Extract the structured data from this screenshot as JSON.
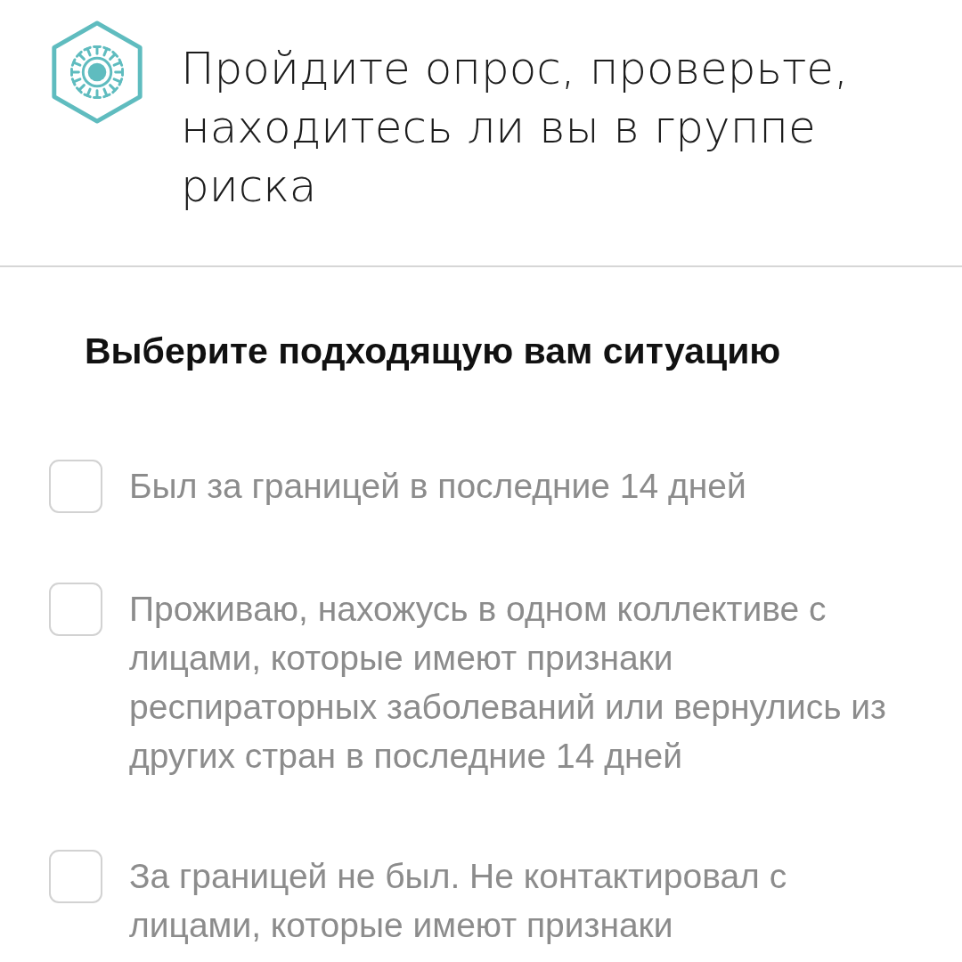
{
  "header": {
    "title": "Пройдите опрос, проверьте, находитесь ли вы в группе риска"
  },
  "question": {
    "title": "Выберите подходящую вам ситуацию"
  },
  "options": [
    {
      "label": "Был за границей в последние 14 дней",
      "checked": false
    },
    {
      "label": "Проживаю, нахожусь в одном коллективе с лицами, которые имеют признаки респираторных заболеваний или вернулись из других стран в последние 14 дней",
      "checked": false
    },
    {
      "label": "За границей не был. Не контактировал с лицами, которые имеют признаки",
      "checked": false
    }
  ]
}
